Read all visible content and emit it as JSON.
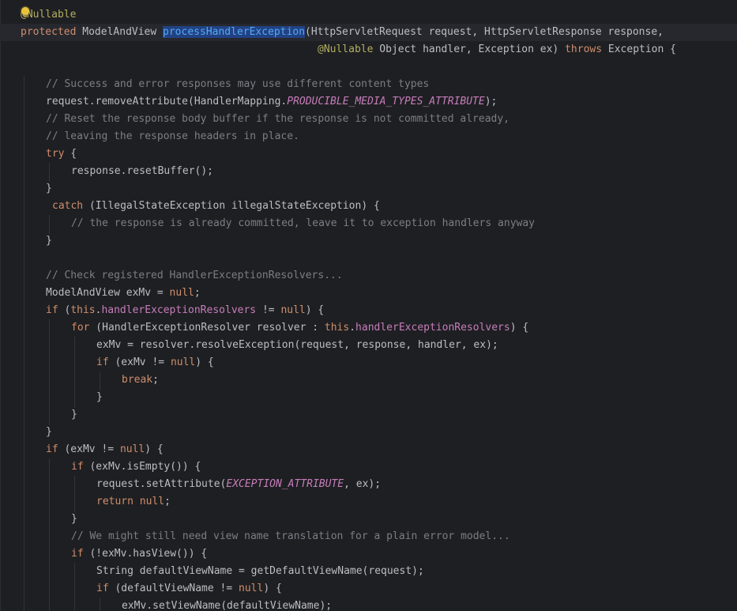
{
  "colors": {
    "background": "#1e1f22",
    "text": "#bcbec4",
    "keyword": "#cf8e6d",
    "annotation": "#b3ae60",
    "comment": "#7a7e85",
    "field": "#c77dbb",
    "function_decl": "#56a8f5",
    "selection": "#214283",
    "bulb": "#e8c33a"
  },
  "icons": {
    "intention_bulb": "lightbulb-icon"
  },
  "code_lines": [
    {
      "tokens": [
        {
          "t": "@Nullable",
          "c": "ann"
        }
      ]
    },
    {
      "tokens": [
        {
          "t": "protected",
          "c": "kw"
        },
        {
          "t": " ModelAndView "
        },
        {
          "t": "processHandlerException",
          "c": "fn sel"
        },
        {
          "t": "(HttpServletRequest request, HttpServletResponse response,"
        }
      ]
    },
    {
      "tokens": [
        {
          "t": "@Nullable",
          "c": "ann"
        },
        {
          "t": " Object handler, Exception ex) "
        },
        {
          "t": "throws",
          "c": "kw"
        },
        {
          "t": " Exception {"
        }
      ]
    },
    {
      "tokens": []
    },
    {
      "tokens": [
        {
          "t": "// Success and error responses may use different content types",
          "c": "cm"
        }
      ]
    },
    {
      "tokens": [
        {
          "t": "request.removeAttribute(HandlerMapping."
        },
        {
          "t": "PRODUCIBLE_MEDIA_TYPES_ATTRIBUTE",
          "c": "cst"
        },
        {
          "t": ");"
        }
      ]
    },
    {
      "tokens": [
        {
          "t": "// Reset the response body buffer if the response is not committed already,",
          "c": "cm"
        }
      ]
    },
    {
      "tokens": [
        {
          "t": "// leaving the response headers in place.",
          "c": "cm"
        }
      ]
    },
    {
      "tokens": [
        {
          "t": "try",
          "c": "kw"
        },
        {
          "t": " {"
        }
      ]
    },
    {
      "tokens": [
        {
          "t": "response.resetBuffer();"
        }
      ]
    },
    {
      "tokens": [
        {
          "t": "}"
        }
      ]
    },
    {
      "tokens": [
        {
          "t": "catch",
          "c": "kw"
        },
        {
          "t": " (IllegalStateException illegalStateException) {"
        }
      ]
    },
    {
      "tokens": [
        {
          "t": "// the response is already committed, leave it to exception handlers anyway",
          "c": "cm"
        }
      ]
    },
    {
      "tokens": [
        {
          "t": "}"
        }
      ]
    },
    {
      "tokens": []
    },
    {
      "tokens": [
        {
          "t": "// Check registered HandlerExceptionResolvers...",
          "c": "cm"
        }
      ]
    },
    {
      "tokens": [
        {
          "t": "ModelAndView exMv = "
        },
        {
          "t": "null",
          "c": "kw"
        },
        {
          "t": ";"
        }
      ]
    },
    {
      "tokens": [
        {
          "t": "if",
          "c": "kw"
        },
        {
          "t": " ("
        },
        {
          "t": "this",
          "c": "kw"
        },
        {
          "t": "."
        },
        {
          "t": "handlerExceptionResolvers",
          "c": "fld"
        },
        {
          "t": " != "
        },
        {
          "t": "null",
          "c": "kw"
        },
        {
          "t": ") {"
        }
      ]
    },
    {
      "tokens": [
        {
          "t": "for",
          "c": "kw"
        },
        {
          "t": " (HandlerExceptionResolver resolver : "
        },
        {
          "t": "this",
          "c": "kw"
        },
        {
          "t": "."
        },
        {
          "t": "handlerExceptionResolvers",
          "c": "fld"
        },
        {
          "t": ") {"
        }
      ]
    },
    {
      "tokens": [
        {
          "t": "exMv = resolver.resolveException(request, response, handler, ex);"
        }
      ]
    },
    {
      "tokens": [
        {
          "t": "if",
          "c": "kw"
        },
        {
          "t": " (exMv != "
        },
        {
          "t": "null",
          "c": "kw"
        },
        {
          "t": ") {"
        }
      ]
    },
    {
      "tokens": [
        {
          "t": "break",
          "c": "kw"
        },
        {
          "t": ";"
        }
      ]
    },
    {
      "tokens": [
        {
          "t": "}"
        }
      ]
    },
    {
      "tokens": [
        {
          "t": "}"
        }
      ]
    },
    {
      "tokens": [
        {
          "t": "}"
        }
      ]
    },
    {
      "tokens": [
        {
          "t": "if",
          "c": "kw"
        },
        {
          "t": " (exMv != "
        },
        {
          "t": "null",
          "c": "kw"
        },
        {
          "t": ") {"
        }
      ]
    },
    {
      "tokens": [
        {
          "t": "if",
          "c": "kw"
        },
        {
          "t": " (exMv.isEmpty()) {"
        }
      ]
    },
    {
      "tokens": [
        {
          "t": "request.setAttribute("
        },
        {
          "t": "EXCEPTION_ATTRIBUTE",
          "c": "cst"
        },
        {
          "t": ", ex);"
        }
      ]
    },
    {
      "tokens": [
        {
          "t": "return",
          "c": "kw"
        },
        {
          "t": " "
        },
        {
          "t": "null",
          "c": "kw"
        },
        {
          "t": ";"
        }
      ]
    },
    {
      "tokens": [
        {
          "t": "}"
        }
      ]
    },
    {
      "tokens": [
        {
          "t": "// We might still need view name translation for a plain error model...",
          "c": "cm"
        }
      ]
    },
    {
      "tokens": [
        {
          "t": "if",
          "c": "kw"
        },
        {
          "t": " (!exMv.hasView()) {"
        }
      ]
    },
    {
      "tokens": [
        {
          "t": "String defaultViewName = getDefaultViewName(request);"
        }
      ]
    },
    {
      "tokens": [
        {
          "t": "if",
          "c": "kw"
        },
        {
          "t": " (defaultViewName != "
        },
        {
          "t": "null",
          "c": "kw"
        },
        {
          "t": ") {"
        }
      ]
    },
    {
      "tokens": [
        {
          "t": "exMv.setViewName(defaultViewName);"
        }
      ]
    }
  ]
}
